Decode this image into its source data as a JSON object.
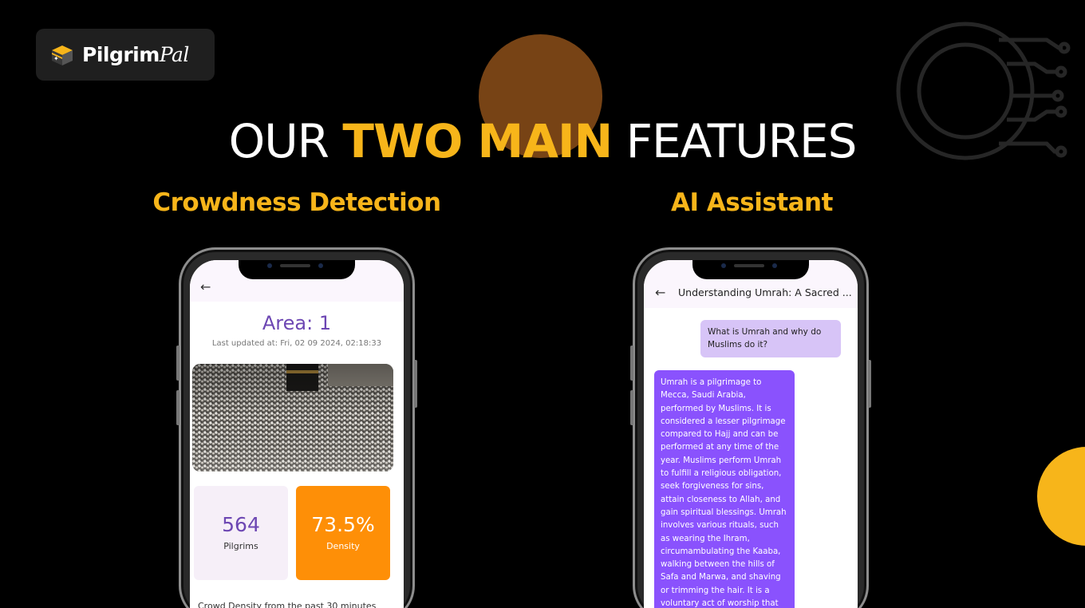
{
  "brand": {
    "name_part1": "Pilgrim",
    "name_part2": "Pal"
  },
  "headline": {
    "part1": "OUR",
    "part2": "TWO MAIN",
    "part3": "FEATURES"
  },
  "features": [
    {
      "title": "Crowdness Detection"
    },
    {
      "title": "AI Assistant"
    }
  ],
  "colors": {
    "accent_yellow": "#f7b51a",
    "accent_brown": "#774315",
    "purple": "#6d47b3",
    "orange": "#fe8f07",
    "chat_purple": "#8a52fd",
    "user_bubble": "#d7c4f7"
  },
  "crowd_screen": {
    "back_icon": "arrow-left-icon",
    "area_title": "Area: 1",
    "last_updated": "Last updated at: Fri, 02 09 2024, 02:18:33",
    "stats": [
      {
        "value": "564",
        "label": "Pilgrims"
      },
      {
        "value": "73.5%",
        "label": "Density"
      }
    ],
    "caption": "Crowd Density from the past 30 minutes"
  },
  "chat_screen": {
    "back_icon": "arrow-left-icon",
    "title": "Understanding Umrah: A Sacred ...",
    "user_message": "What is Umrah and why do Muslims do it?",
    "assistant_message": "Umrah is a pilgrimage to Mecca, Saudi Arabia, performed by Muslims. It is considered a lesser pilgrimage compared to Hajj and can be performed at any time of the year. Muslims perform Umrah to fulfill a religious obligation, seek forgiveness for sins, attain closeness to Allah, and gain spiritual blessings. Umrah involves various rituals, such as wearing the Ihram, circumambulating the Kaaba, walking between the hills of Safa and Marwa, and shaving or trimming the hair. It is a voluntary act of worship that"
  }
}
